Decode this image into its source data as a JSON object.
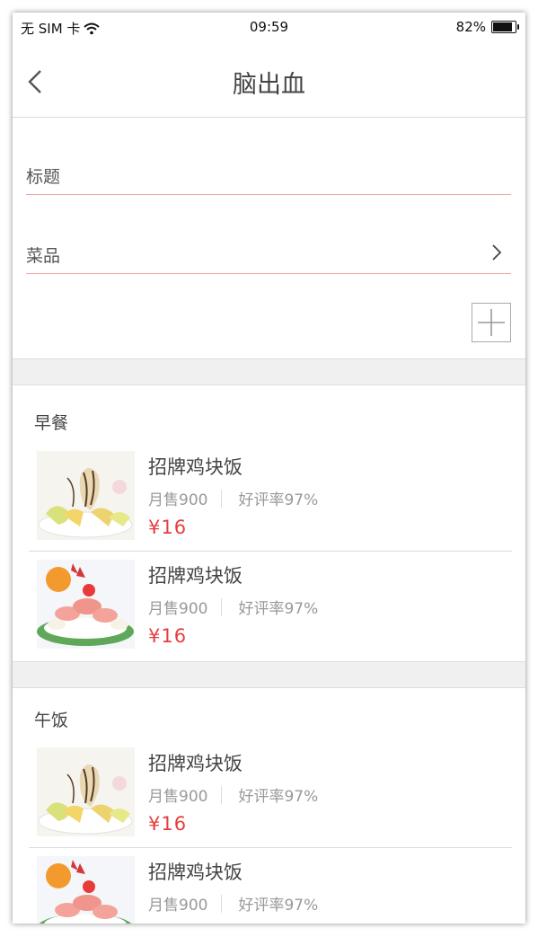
{
  "status": {
    "carrier": "无 SIM 卡",
    "time": "09:59",
    "battery": "82%",
    "battery_level": 0.82
  },
  "header": {
    "title": "脑出血"
  },
  "form": {
    "title_label": "标题",
    "dish_label": "菜品"
  },
  "sections": [
    {
      "title": "早餐",
      "items": [
        {
          "name": "招牌鸡块饭",
          "sales": "月售900",
          "rating": "好评率97%",
          "price": "¥16"
        },
        {
          "name": "招牌鸡块饭",
          "sales": "月售900",
          "rating": "好评率97%",
          "price": "¥16"
        }
      ]
    },
    {
      "title": "午饭",
      "items": [
        {
          "name": "招牌鸡块饭",
          "sales": "月售900",
          "rating": "好评率97%",
          "price": "¥16"
        },
        {
          "name": "招牌鸡块饭",
          "sales": "月售900",
          "rating": "好评率97%",
          "price": ""
        }
      ]
    }
  ],
  "colors": {
    "price": "#e53e3e",
    "field_underline": "#f0a8a8",
    "divider": "#f0f0f0"
  }
}
